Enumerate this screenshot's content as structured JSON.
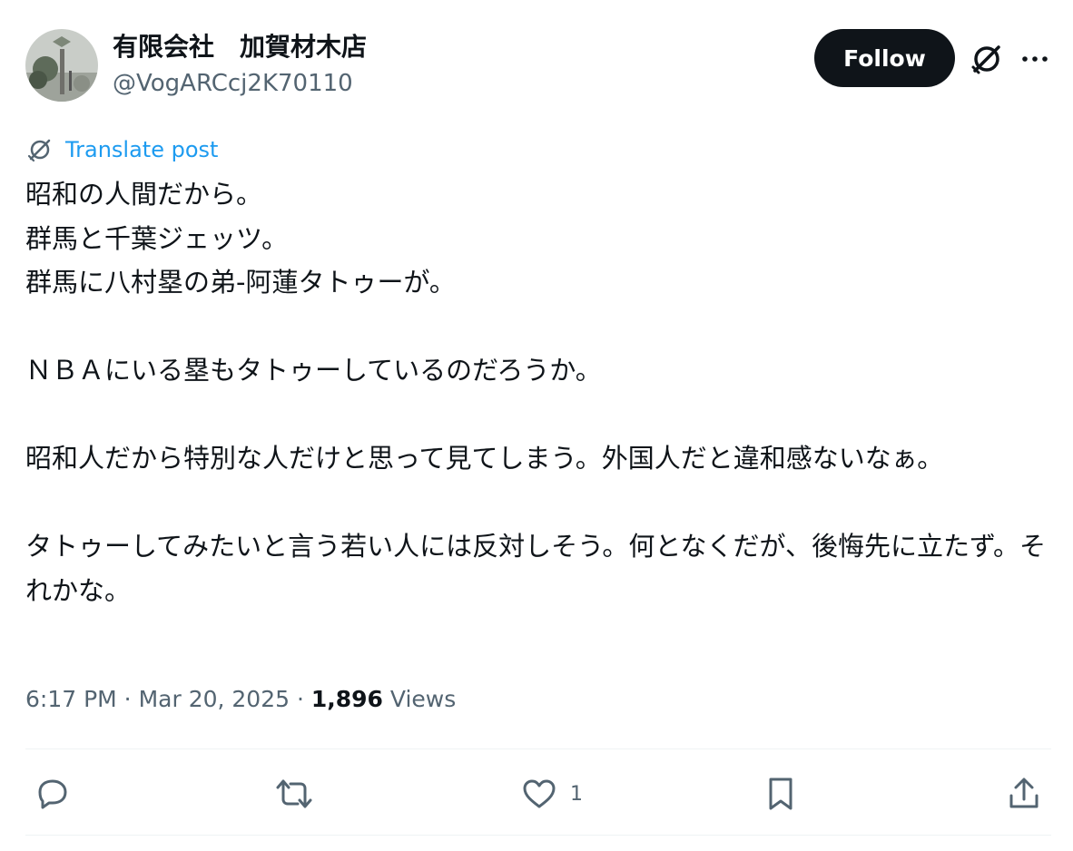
{
  "author": {
    "display_name": "有限会社　加賀材木店",
    "handle": "@VogARCcj2K70110"
  },
  "header": {
    "follow_label": "Follow"
  },
  "translate_label": "Translate post",
  "post": {
    "text": "昭和の人間だから。\n群馬と千葉ジェッツ。\n群馬に八村塁の弟-阿蓮タトゥーが。\n\nＮＢＡにいる塁もタトゥーしているのだろうか。\n\n昭和人だから特別な人だけと思って見てしまう。外国人だと違和感ないなぁ。\n\nタトゥーしてみたいと言う若い人には反対しそう。何となくだが、後悔先に立たず。それかな。"
  },
  "meta": {
    "time": "6:17 PM",
    "date": "Mar 20, 2025",
    "views_count": "1,896",
    "views_label": "Views",
    "separator": " · "
  },
  "actions": {
    "like_count": "1"
  },
  "colors": {
    "accent": "#1d9bf0",
    "text_primary": "#0f1419",
    "text_secondary": "#536471",
    "divider": "#eff3f4",
    "button_bg": "#0f1419"
  },
  "icons": {
    "grok": "grok-icon",
    "more": "more-icon",
    "translate": "translate-icon",
    "reply": "reply-icon",
    "repost": "repost-icon",
    "like": "like-icon",
    "bookmark": "bookmark-icon",
    "share": "share-icon"
  }
}
